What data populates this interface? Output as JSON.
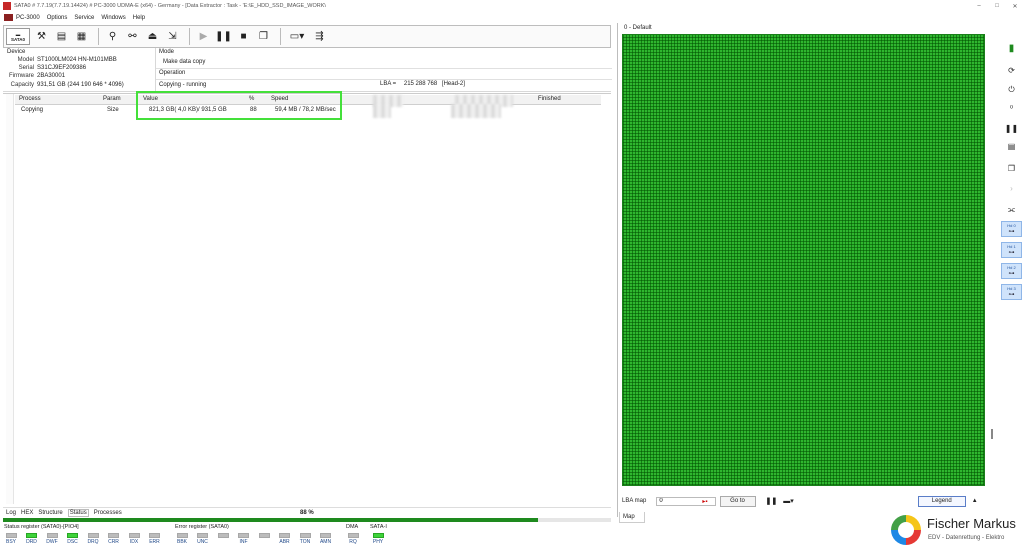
{
  "window": {
    "title": "SATA0 # 7.7.19(7.7.19.14424) # PC-3000 UDMA-E (x64) - Germany - [Data Extractor : Task - 'E:\\E_HDD_SSD_IMAGE_WORK\\",
    "minimize": "–",
    "maximize": "□",
    "close": "✕"
  },
  "menu": [
    "PC-3000",
    "Options",
    "Service",
    "Windows",
    "Help"
  ],
  "toolbar": {
    "sata_label": "SATA0"
  },
  "device": {
    "heading": "Device",
    "fields": [
      {
        "label": "Model",
        "value": "ST1000LM024 HN-M101MBB"
      },
      {
        "label": "Serial",
        "value": "S31CJ9EF209386"
      },
      {
        "label": "Firmware",
        "value": "2BA30001"
      },
      {
        "label": "Capacity",
        "value": "931,51 GB (244 190 646 * 4096)"
      }
    ]
  },
  "mode": {
    "heading": "Mode",
    "task": "Make data copy",
    "operation_label": "Operation",
    "status": "Copying - running",
    "lba_label": "LBA =",
    "lba_value": "215 288 768",
    "head": "[Head-2]"
  },
  "table": {
    "columns": [
      "Process",
      "Param",
      "Value",
      "%",
      "Speed",
      "Finished"
    ],
    "rows": [
      {
        "process": "Copying",
        "param": "Size",
        "value": "821,3 GB( 4,0 KB)/ 931,5 GB",
        "percent": "88",
        "speed": "59,4 MB / 78,2 MB/sec"
      }
    ]
  },
  "bottom_tabs": [
    "Log",
    "HEX",
    "Structure",
    "Status",
    "Processes"
  ],
  "active_tab": "Status",
  "progress": {
    "label": "88 %",
    "fraction": 0.88
  },
  "status_register": {
    "title": "Status register (SATA0)-[PIO4]",
    "leds": [
      {
        "name": "BSY",
        "on": false
      },
      {
        "name": "DRD",
        "on": true
      },
      {
        "name": "DWF",
        "on": false
      },
      {
        "name": "DSC",
        "on": true
      },
      {
        "name": "DRQ",
        "on": false
      },
      {
        "name": "CRR",
        "on": false
      },
      {
        "name": "IDX",
        "on": false
      },
      {
        "name": "ERR",
        "on": false
      }
    ]
  },
  "error_register": {
    "title": "Error register (SATA0)",
    "leds": [
      {
        "name": "BBK",
        "on": false
      },
      {
        "name": "UNC",
        "on": false
      },
      {
        "name": "",
        "on": false
      },
      {
        "name": "INF",
        "on": false
      },
      {
        "name": "",
        "on": false
      },
      {
        "name": "ABR",
        "on": false
      },
      {
        "name": "TON",
        "on": false
      },
      {
        "name": "AMN",
        "on": false
      }
    ]
  },
  "dma": {
    "title": "DMA",
    "led": {
      "name": "RQ",
      "on": false
    }
  },
  "sata": {
    "title": "SATA-I",
    "led": {
      "name": "PHY",
      "on": true
    }
  },
  "map": {
    "title": "0 - Default",
    "lba_map_label": "LBA map",
    "lba_input": "0",
    "goto_label": "Go to",
    "legend_label": "Legend",
    "tab_label": "Map",
    "fill_color": "#2fb62f"
  },
  "sidebar": {
    "heads": [
      "Hd 0",
      "Hd 1",
      "Hd 2",
      "Hd 3"
    ]
  },
  "logo": {
    "name": "Fischer Markus",
    "sub": "EDV - Datenrettung - Elektro"
  }
}
